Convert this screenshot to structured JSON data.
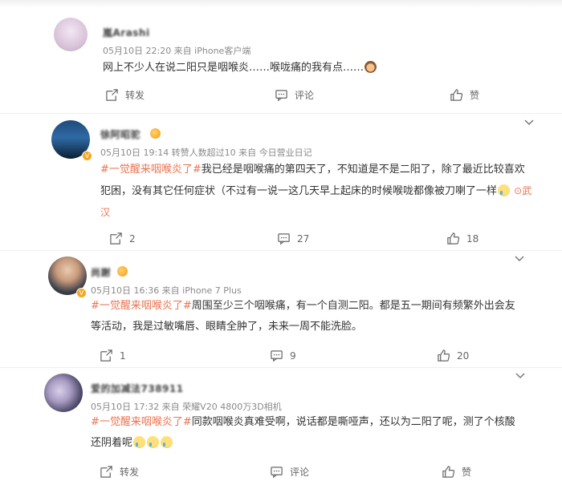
{
  "comments": [
    {
      "username": "嵐Arashi",
      "meta": "05月10日 22:20  来自 iPhone客户端",
      "tag": "",
      "body": "网上不少人在说二阳只是咽喉炎……喉咙痛的我有点……",
      "location": "",
      "actions": {
        "repost": "转发",
        "comment": "评论",
        "like": "赞"
      }
    },
    {
      "username": "徐阿昭驼",
      "meta": "05月10日 19:14  转赞人数超过10  来自 今日营业日记",
      "tag": "#一觉醒来咽喉炎了#",
      "body": "我已经是咽喉痛的第四天了，不知道是不是二阳了，除了最近比较喜欢犯困，没有其它任何症状（不过有一说一这几天早上起床的时候喉咙都像被刀喇了一样",
      "location": "武汉",
      "actions": {
        "repost": "2",
        "comment": "27",
        "like": "18"
      }
    },
    {
      "username": "尚謝",
      "meta": "05月10日 16:36  来自 iPhone 7 Plus",
      "tag": "#一觉醒来咽喉炎了#",
      "body": "周围至少三个咽喉痛，有一个自测二阳。都是五一期间有频繁外出会友等活动，我是过敏嘴唇、眼睛全肿了，未来一周不能洗脸。",
      "location": "",
      "actions": {
        "repost": "1",
        "comment": "9",
        "like": "20"
      }
    },
    {
      "username": "爱的加减法738911",
      "meta": "05月10日 17:32  来自 荣耀V20 4800万3D相机",
      "tag": "#一觉醒来咽喉炎了#",
      "body": "同款咽喉炎真难受啊，说话都是嘶哑声，还以为二阳了呢，测了个核酸还阴着呢",
      "location": "",
      "actions": {
        "repost": "转发",
        "comment": "评论",
        "like": "赞"
      }
    }
  ]
}
